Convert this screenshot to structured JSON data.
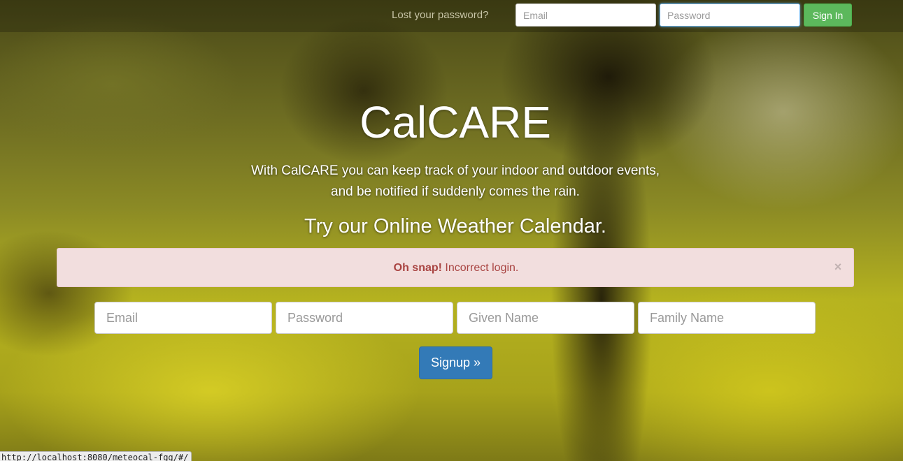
{
  "navbar": {
    "lost_password_link": "Lost your password?",
    "email_placeholder": "Email",
    "password_placeholder": "Password",
    "signin_label": "Sign In"
  },
  "hero": {
    "title": "CalCARE",
    "description_line1": "With CalCARE you can keep track of your indoor and outdoor events,",
    "description_line2": "and be notified if suddenly comes the rain.",
    "subtitle": "Try our Online Weather Calendar."
  },
  "alert": {
    "strong_text": "Oh snap!",
    "message": "Incorrect login.",
    "close_glyph": "×"
  },
  "signup": {
    "email_placeholder": "Email",
    "password_placeholder": "Password",
    "given_name_placeholder": "Given Name",
    "family_name_placeholder": "Family Name",
    "button_label": "Signup »"
  },
  "status_bar": {
    "url": "http://localhost:8080/meteocal-fgg/#/"
  },
  "colors": {
    "signin_green": "#5cb85c",
    "signup_blue": "#337ab7",
    "alert_bg": "#f2dede",
    "alert_text": "#a94442"
  }
}
